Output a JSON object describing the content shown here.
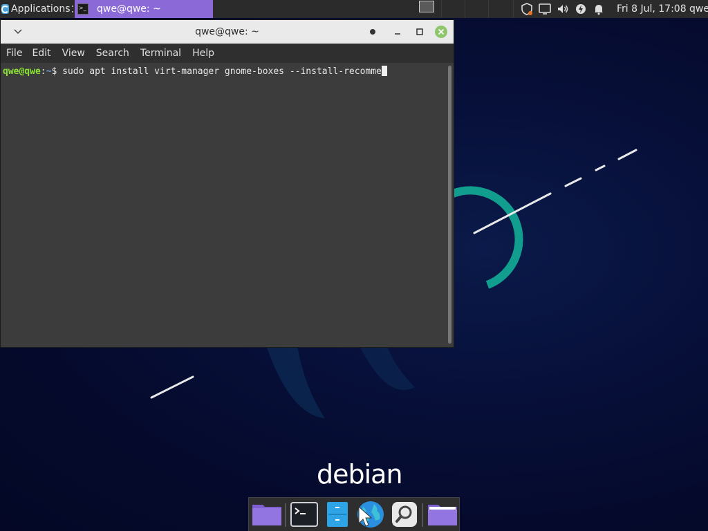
{
  "top_panel": {
    "applications_label": "Applications",
    "task": {
      "title": "qwe@qwe: ~"
    },
    "clock": "Fri  8 Jul, 17:08",
    "user": "qwe",
    "tray_icons": [
      "shield-icon",
      "display-icon",
      "volume-icon",
      "power-icon",
      "notification-bell-icon"
    ]
  },
  "desktop": {
    "wordmark": "debian"
  },
  "window": {
    "title": "qwe@qwe: ~",
    "menu": [
      "File",
      "Edit",
      "View",
      "Search",
      "Terminal",
      "Help"
    ],
    "terminal": {
      "prompt_user": "qwe@qwe",
      "prompt_sep": ":",
      "prompt_path": "~",
      "prompt_symbol": "$ ",
      "command": "sudo apt install virt-manager gnome-boxes --install-recomme"
    }
  },
  "dock": {
    "items": [
      "folder-icon",
      "terminal-icon",
      "file-manager-icon",
      "web-browser-icon",
      "search-icon",
      "folder-icon"
    ]
  },
  "colors": {
    "accent": "#8b6ad8",
    "prompt_user": "#8ae234",
    "prompt_path": "#729fcf",
    "teal": "#129e8f"
  }
}
